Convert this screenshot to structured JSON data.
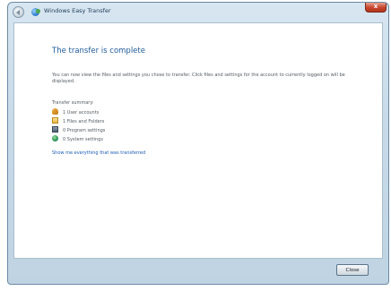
{
  "window": {
    "title": "Windows Easy Transfer",
    "close_glyph": "x"
  },
  "main": {
    "heading": "The transfer is complete",
    "description": "You can now view the files and settings you chose to transfer. Click files and settings for the account to currently logged on will be displayed.",
    "transfer_label": "Transfer summary:",
    "items": [
      {
        "icon": "users-icon",
        "label": "1 User accounts"
      },
      {
        "icon": "folder-icon",
        "label": "1 Files and Folders"
      },
      {
        "icon": "program-icon",
        "label": "0 Program settings"
      },
      {
        "icon": "system-icon",
        "label": "0 System settings"
      }
    ],
    "see_link": "Show me everything that was transferred"
  },
  "footer": {
    "close_label": "Close"
  },
  "colors": {
    "heading": "#1f5a9a",
    "link": "#1b5bb8",
    "close_button": "#c7452b"
  }
}
